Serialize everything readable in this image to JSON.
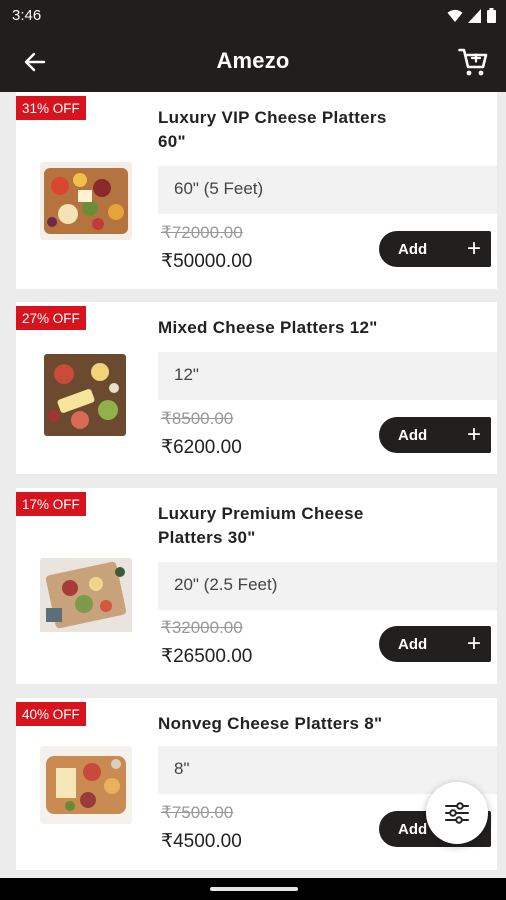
{
  "status_bar": {
    "time": "3:46"
  },
  "app_bar": {
    "title": "Amezo",
    "back_icon": "arrow-left-icon",
    "cart_icon": "cart-icon"
  },
  "products": [
    {
      "discount": "31% OFF",
      "title": "Luxury VIP Cheese Platters 60\"",
      "variant": "60\" (5 Feet)",
      "old_price": "₹72000.00",
      "price": "₹50000.00",
      "add_label": "Add",
      "plus": "+"
    },
    {
      "discount": "27% OFF",
      "title": "Mixed Cheese Platters 12\"",
      "variant": "12\"",
      "old_price": "₹8500.00",
      "price": "₹6200.00",
      "add_label": "Add",
      "plus": "+"
    },
    {
      "discount": "17% OFF",
      "title": "Luxury Premium Cheese Platters 30\"",
      "variant": "20\" (2.5 Feet)",
      "old_price": "₹32000.00",
      "price": "₹26500.00",
      "add_label": "Add",
      "plus": "+"
    },
    {
      "discount": "40% OFF",
      "title": "Nonveg Cheese Platters 8\"",
      "variant": "8\"",
      "old_price": "₹7500.00",
      "price": "₹4500.00",
      "add_label": "Add",
      "plus": "+"
    }
  ],
  "fab": {
    "icon": "filter-sliders-icon"
  },
  "colors": {
    "bar_bg": "#211e1e",
    "badge_red": "#d7131d",
    "button_dark": "#221f1f"
  }
}
